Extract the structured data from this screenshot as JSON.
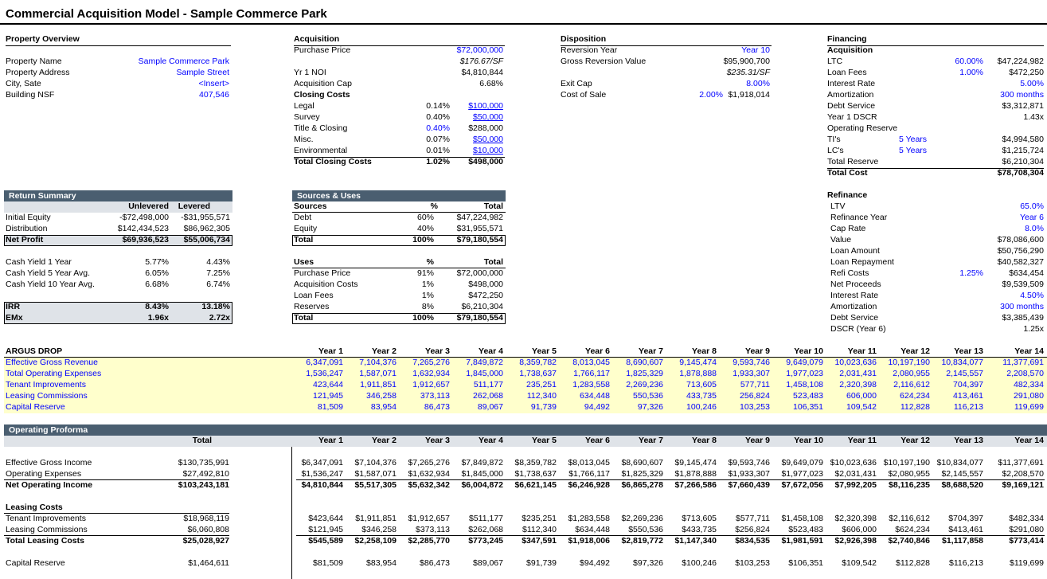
{
  "title": "Commercial Acquisition Model - Sample Commerce Park",
  "property": {
    "heading": "Property Overview",
    "rows": [
      {
        "label": "Property Name",
        "value": "Sample Commerce Park"
      },
      {
        "label": "Property Address",
        "value": "Sample Street"
      },
      {
        "label": "City, Sate",
        "value": "<Insert>"
      },
      {
        "label": "Building NSF",
        "value": "407,546"
      }
    ]
  },
  "acquisition": {
    "heading": "Acquisition",
    "purchase_label": "Purchase Price",
    "purchase_value": "$72,000,000",
    "psf": "$176.67/SF",
    "noi_label": "Yr 1 NOI",
    "noi_value": "$4,810,844",
    "cap_label": "Acquisition Cap",
    "cap_value": "6.68%",
    "closing_heading": "Closing  Costs",
    "closing": [
      {
        "label": "Legal",
        "pct": "0.14%",
        "value": "$100,000"
      },
      {
        "label": "Survey",
        "pct": "0.40%",
        "value": "$50,000"
      },
      {
        "label": "Title & Closing",
        "pct": "0.40%",
        "value": "$288,000"
      },
      {
        "label": "Misc.",
        "pct": "0.07%",
        "value": "$50,000"
      },
      {
        "label": "Environmental",
        "pct": "0.01%",
        "value": "$10,000"
      }
    ],
    "total_label": "Total Closing Costs",
    "total_pct": "1.02%",
    "total_value": "$498,000"
  },
  "disposition": {
    "heading": "Disposition",
    "rev_year_label": "Reversion Year",
    "rev_year_value": "Year 10",
    "gross_label": "Gross Reversion Value",
    "gross_value": "$95,900,700",
    "gross_psf": "$235.31/SF",
    "exit_label": "Exit Cap",
    "exit_value": "8.00%",
    "cos_label": "Cost of Sale",
    "cos_pct": "2.00%",
    "cos_value": "$1,918,014"
  },
  "financing": {
    "heading": "Financing",
    "acq_heading": "Acquisition",
    "rows": [
      {
        "label": "LTC",
        "mid": "60.00%",
        "value": "$47,224,982",
        "blue": false
      },
      {
        "label": "Loan Fees",
        "mid": "1.00%",
        "value": "$472,250",
        "blue": false
      },
      {
        "label": "Interest Rate",
        "mid": "",
        "value": "5.00%",
        "blue": true
      },
      {
        "label": "Amortization",
        "mid": "",
        "value": "300 months",
        "blue": true
      },
      {
        "label": "Debt Service",
        "mid": "",
        "value": "$3,312,871",
        "blue": false
      },
      {
        "label": "Year 1 DSCR",
        "mid": "",
        "value": "1.43x",
        "blue": false
      },
      {
        "label": "Operating Reserve",
        "mid": "",
        "value": "",
        "blue": false
      },
      {
        "label": "TI's",
        "mid": "5 Years",
        "value": "$4,994,580",
        "blue": false
      },
      {
        "label": "LC's",
        "mid": "5 Years",
        "value": "$1,215,724",
        "blue": false
      },
      {
        "label": "Total Reserve",
        "mid": "",
        "value": "$6,210,304",
        "blue": false
      }
    ],
    "total_cost_label": "Total Cost",
    "total_cost_value": "$78,708,304",
    "refi_heading": "Refinance",
    "refi": [
      {
        "label": "LTV",
        "mid": "",
        "value": "65.0%",
        "blue": true
      },
      {
        "label": "Refinance Year",
        "mid": "",
        "value": "Year 6",
        "blue": true
      },
      {
        "label": "Cap Rate",
        "mid": "",
        "value": "8.0%",
        "blue": true
      },
      {
        "label": "Value",
        "mid": "",
        "value": "$78,086,600",
        "blue": false
      },
      {
        "label": "Loan Amount",
        "mid": "",
        "value": "$50,756,290",
        "blue": false
      },
      {
        "label": "Loan Repayment",
        "mid": "",
        "value": "$40,582,327",
        "blue": false
      },
      {
        "label": "Refi Costs",
        "mid": "1.25%",
        "value": "$634,454",
        "blue": false
      },
      {
        "label": "Net Proceeds",
        "mid": "",
        "value": "$9,539,509",
        "blue": false
      },
      {
        "label": "Interest Rate",
        "mid": "",
        "value": "4.50%",
        "blue": true
      },
      {
        "label": "Amortization",
        "mid": "",
        "value": "300 months",
        "blue": true
      },
      {
        "label": "Debt Service",
        "mid": "",
        "value": "$3,385,439",
        "blue": false
      },
      {
        "label": "DSCR (Year 6)",
        "mid": "",
        "value": "1.25x",
        "blue": false
      }
    ]
  },
  "returns": {
    "heading": "Return Summary",
    "col1": "Unlevered",
    "col2": "Levered",
    "rows": [
      {
        "label": "Initial Equity",
        "u": "-$72,498,000",
        "l": "-$31,955,571"
      },
      {
        "label": "Distribution",
        "u": "$142,434,523",
        "l": "$86,962,305"
      }
    ],
    "net_label": "Net Profit",
    "net_u": "$69,936,523",
    "net_l": "$55,006,734",
    "yields": [
      {
        "label": "Cash Yield 1 Year",
        "u": "5.77%",
        "l": "4.43%"
      },
      {
        "label": "Cash Yield 5 Year Avg.",
        "u": "6.05%",
        "l": "7.25%"
      },
      {
        "label": "Cash Yield 10 Year Avg.",
        "u": "6.68%",
        "l": "6.74%"
      }
    ],
    "irr_label": "IRR",
    "irr_u": "8.43%",
    "irr_l": "13.18%",
    "emx_label": "EMx",
    "emx_u": "1.96x",
    "emx_l": "2.72x"
  },
  "sources_uses": {
    "heading": "Sources & Uses",
    "src_label": "Sources",
    "pct_label": "%",
    "total_label": "Total",
    "sources": [
      {
        "label": "Debt",
        "pct": "60%",
        "value": "$47,224,982"
      },
      {
        "label": "Equity",
        "pct": "40%",
        "value": "$31,955,571"
      }
    ],
    "src_total": {
      "label": "Total",
      "pct": "100%",
      "value": "$79,180,554"
    },
    "uses_label": "Uses",
    "uses": [
      {
        "label": "Purchase Price",
        "pct": "91%",
        "value": "$72,000,000"
      },
      {
        "label": "Acquisition Costs",
        "pct": "1%",
        "value": "$498,000"
      },
      {
        "label": "Loan Fees",
        "pct": "1%",
        "value": "$472,250"
      },
      {
        "label": "Reserves",
        "pct": "8%",
        "value": "$6,210,304"
      }
    ],
    "uses_total": {
      "label": "Total",
      "pct": "100%",
      "value": "$79,180,554"
    }
  },
  "argus": {
    "heading": "ARGUS DROP",
    "years": [
      "Year 1",
      "Year 2",
      "Year 3",
      "Year 4",
      "Year 5",
      "Year 6",
      "Year 7",
      "Year 8",
      "Year 9",
      "Year 10",
      "Year 11",
      "Year 12",
      "Year 13",
      "Year 14"
    ],
    "rows": [
      {
        "label": "Effective Gross Revenue",
        "values": [
          "6,347,091",
          "7,104,376",
          "7,265,276",
          "7,849,872",
          "8,359,782",
          "8,013,045",
          "8,690,607",
          "9,145,474",
          "9,593,746",
          "9,649,079",
          "10,023,636",
          "10,197,190",
          "10,834,077",
          "11,377,691"
        ]
      },
      {
        "label": "Total Operating Expenses",
        "values": [
          "1,536,247",
          "1,587,071",
          "1,632,934",
          "1,845,000",
          "1,738,637",
          "1,766,117",
          "1,825,329",
          "1,878,888",
          "1,933,307",
          "1,977,023",
          "2,031,431",
          "2,080,955",
          "2,145,557",
          "2,208,570"
        ]
      },
      {
        "label": "Tenant Improvements",
        "values": [
          "423,644",
          "1,911,851",
          "1,912,657",
          "511,177",
          "235,251",
          "1,283,558",
          "2,269,236",
          "713,605",
          "577,711",
          "1,458,108",
          "2,320,398",
          "2,116,612",
          "704,397",
          "482,334"
        ]
      },
      {
        "label": "Leasing Commissions",
        "values": [
          "121,945",
          "346,258",
          "373,113",
          "262,068",
          "112,340",
          "634,448",
          "550,536",
          "433,735",
          "256,824",
          "523,483",
          "606,000",
          "624,234",
          "413,461",
          "291,080"
        ]
      },
      {
        "label": "Capital Reserve",
        "values": [
          "81,509",
          "83,954",
          "86,473",
          "89,067",
          "91,739",
          "94,492",
          "97,326",
          "100,246",
          "103,253",
          "106,351",
          "109,542",
          "112,828",
          "116,213",
          "119,699"
        ]
      }
    ]
  },
  "proforma": {
    "heading": "Operating Proforma",
    "total_label": "Total",
    "years": [
      "Year 1",
      "Year 2",
      "Year 3",
      "Year 4",
      "Year 5",
      "Year 6",
      "Year 7",
      "Year 8",
      "Year 9",
      "Year 10",
      "Year 11",
      "Year 12",
      "Year 13",
      "Year 14"
    ],
    "egi": {
      "label": "Effective Gross Income",
      "total": "$130,735,991",
      "values": [
        "$6,347,091",
        "$7,104,376",
        "$7,265,276",
        "$7,849,872",
        "$8,359,782",
        "$8,013,045",
        "$8,690,607",
        "$9,145,474",
        "$9,593,746",
        "$9,649,079",
        "$10,023,636",
        "$10,197,190",
        "$10,834,077",
        "$11,377,691"
      ]
    },
    "opex": {
      "label": "Operating Expenses",
      "total": "$27,492,810",
      "values": [
        "$1,536,247",
        "$1,587,071",
        "$1,632,934",
        "$1,845,000",
        "$1,738,637",
        "$1,766,117",
        "$1,825,329",
        "$1,878,888",
        "$1,933,307",
        "$1,977,023",
        "$2,031,431",
        "$2,080,955",
        "$2,145,557",
        "$2,208,570"
      ]
    },
    "noi": {
      "label": "Net Operating Income",
      "total": "$103,243,181",
      "values": [
        "$4,810,844",
        "$5,517,305",
        "$5,632,342",
        "$6,004,872",
        "$6,621,145",
        "$6,246,928",
        "$6,865,278",
        "$7,266,586",
        "$7,660,439",
        "$7,672,056",
        "$7,992,205",
        "$8,116,235",
        "$8,688,520",
        "$9,169,121"
      ]
    },
    "leasing_heading": "Leasing Costs",
    "ti": {
      "label": "Tenant Improvements",
      "total": "$18,968,119",
      "values": [
        "$423,644",
        "$1,911,851",
        "$1,912,657",
        "$511,177",
        "$235,251",
        "$1,283,558",
        "$2,269,236",
        "$713,605",
        "$577,711",
        "$1,458,108",
        "$2,320,398",
        "$2,116,612",
        "$704,397",
        "$482,334"
      ]
    },
    "lc": {
      "label": "Leasing Commissions",
      "total": "$6,060,808",
      "values": [
        "$121,945",
        "$346,258",
        "$373,113",
        "$262,068",
        "$112,340",
        "$634,448",
        "$550,536",
        "$433,735",
        "$256,824",
        "$523,483",
        "$606,000",
        "$624,234",
        "$413,461",
        "$291,080"
      ]
    },
    "tlc": {
      "label": "Total Leasing Costs",
      "total": "$25,028,927",
      "values": [
        "$545,589",
        "$2,258,109",
        "$2,285,770",
        "$773,245",
        "$347,591",
        "$1,918,006",
        "$2,819,772",
        "$1,147,340",
        "$834,535",
        "$1,981,591",
        "$2,926,398",
        "$2,740,846",
        "$1,117,858",
        "$773,414"
      ]
    },
    "capres": {
      "label": "Capital Reserve",
      "total": "$1,464,611",
      "values": [
        "$81,509",
        "$83,954",
        "$86,473",
        "$89,067",
        "$91,739",
        "$94,492",
        "$97,326",
        "$100,246",
        "$103,253",
        "$106,351",
        "$109,542",
        "$112,828",
        "$116,213",
        "$119,699"
      ]
    }
  }
}
